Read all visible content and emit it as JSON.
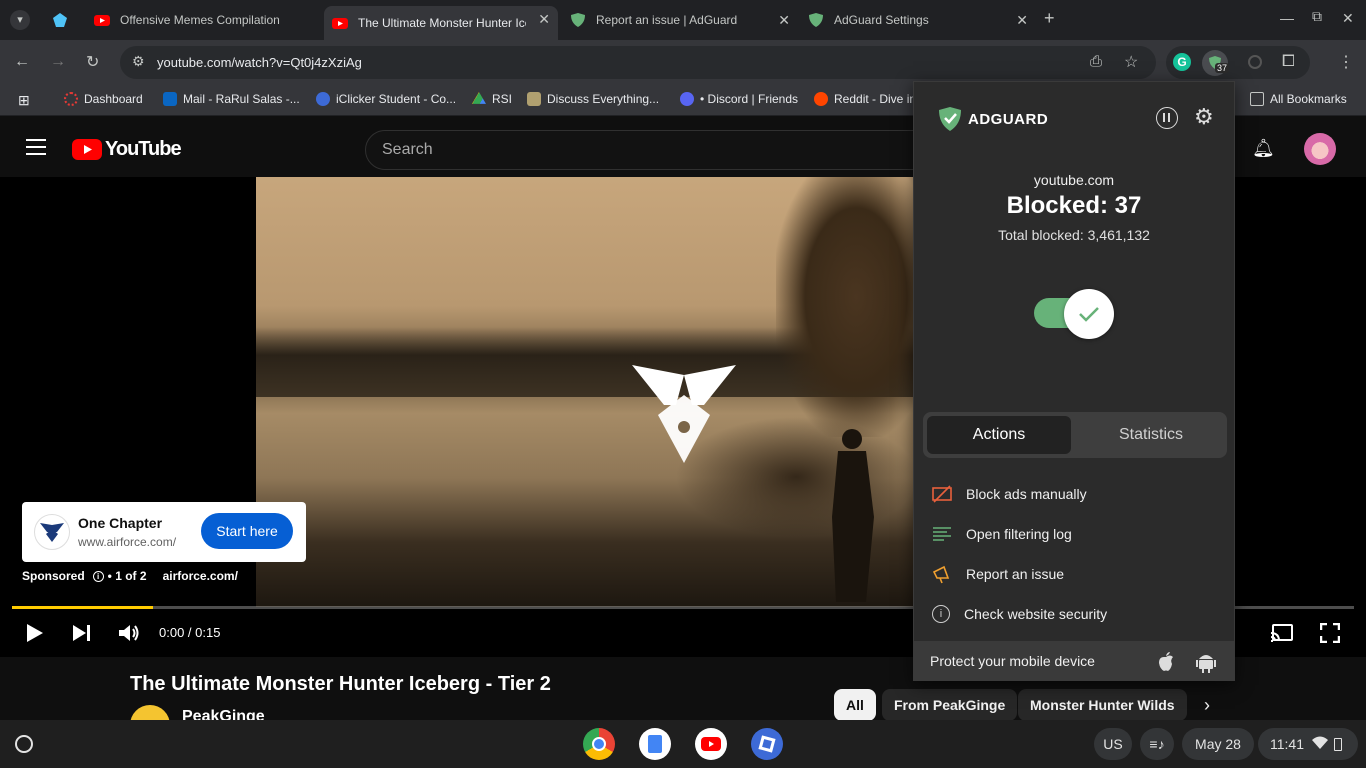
{
  "browser": {
    "tabs": [
      {
        "title": "Offensive Memes Compilation"
      },
      {
        "title": "The Ultimate Monster Hunter Iceberg"
      },
      {
        "title": "Report an issue | AdGuard"
      },
      {
        "title": "AdGuard Settings"
      }
    ],
    "url": "youtube.com/watch?v=Qt0j4zXziAg",
    "extension_badge": "37",
    "bookmarks": [
      {
        "label": "Dashboard",
        "color": "#e53935"
      },
      {
        "label": "Mail - RaRul Salas -...",
        "color": "#0a66c2"
      },
      {
        "label": "iClicker Student - Co...",
        "color": "#3d6ad6"
      },
      {
        "label": "RSI",
        "color": "#34a853"
      },
      {
        "label": "Discuss Everything...",
        "color": "#b0a070"
      },
      {
        "label": "• Discord | Friends",
        "color": "#5865f2"
      },
      {
        "label": "Reddit - Dive in",
        "color": "#ff4500"
      }
    ],
    "all_bookmarks": "All Bookmarks"
  },
  "youtube": {
    "logo_text": "YouTube",
    "search_placeholder": "Search",
    "video_title": "The Ultimate Monster Hunter Iceberg - Tier 2",
    "channel": "PeakGinge",
    "ad": {
      "name": "One Chapter",
      "url": "www.airforce.com/",
      "cta": "Start here",
      "sponsored": "Sponsored",
      "count": "• 1 of 2",
      "domain": "airforce.com/"
    },
    "time": "0:00 / 0:15",
    "progress": 0.105,
    "chips": [
      "All",
      "From PeakGinge",
      "Monster Hunter Wilds"
    ]
  },
  "adguard": {
    "brand": "ADGUARD",
    "site": "youtube.com",
    "blocked": "Blocked: 37",
    "total": "Total blocked: 3,461,132",
    "tabs": {
      "actions": "Actions",
      "statistics": "Statistics"
    },
    "actions": [
      {
        "label": "Block ads manually",
        "icon": "block-ads-icon"
      },
      {
        "label": "Open filtering log",
        "icon": "filtering-log-icon"
      },
      {
        "label": "Report an issue",
        "icon": "megaphone-icon"
      },
      {
        "label": "Check website security",
        "icon": "info-icon"
      }
    ],
    "footer": "Protect your mobile device",
    "accent": "#67b279"
  },
  "shelf": {
    "locale": "US",
    "date": "May 28",
    "time": "11:41"
  }
}
